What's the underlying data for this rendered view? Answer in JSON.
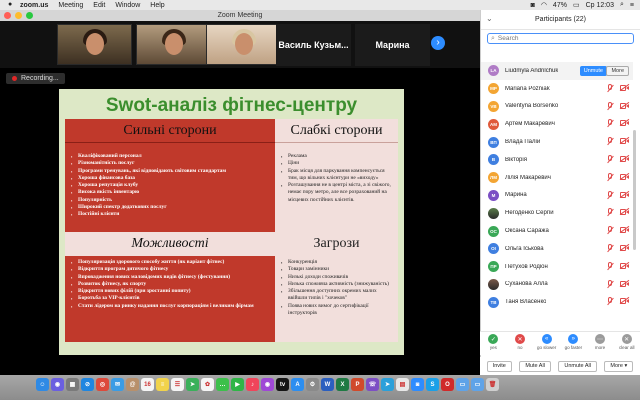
{
  "menubar": {
    "app": "zoom.us",
    "items": [
      "Meeting",
      "Edit",
      "Window",
      "Help"
    ],
    "battery": "47%",
    "time": "Ср 12:03"
  },
  "window": {
    "title": "Zoom Meeting"
  },
  "videos": {
    "names": [
      "Василь Кузьм...",
      "Марина"
    ]
  },
  "recording": {
    "label": "Recording..."
  },
  "slide": {
    "title": "Swot-аналіз фітнес-центру",
    "strengths": {
      "header": "Сильні сторони",
      "items": [
        "Кваліфікований персонал",
        "Різноманітність послуг",
        "Програми тренувань, які відповідають світовим стандартам",
        "Хороша фінансова база",
        "Хороша репутація клубу",
        "Висока якість інвентарю",
        "Популярність",
        "Широкий спектр додаткових послуг",
        "Постійні клієнти"
      ]
    },
    "weaknesses": {
      "header": "Слабкі сторони",
      "items": [
        "Реклама",
        "Ціни",
        "Брак місця для паркування компенсується тим, що вільних клієнтури не «виходу»",
        "Розташування не в центрі міста, а зі свіжого, немає пору метро, але все розрахований на місцевих постійних клієнтів."
      ]
    },
    "opportunities": {
      "header": "Можливості",
      "items": [
        "Популяризація здорового способу життя (як варіант фітнес)",
        "Відкриття програм дитячого фітнесу",
        "Впровадження нових маловідомих видів фітнесу (фестування)",
        "Розвиток фітнесу, як спорту",
        "Відкриття нових філій (при зростанні попиту)",
        "Боротьба за VIP-клієнтів",
        "Стати лідером на ринку надання послуг корпораціям і великим фірмам"
      ]
    },
    "threats": {
      "header": "Загрози",
      "items": [
        "Конкуренція",
        "Товари замінники",
        "Низькі доходи споживачів",
        "Низька споживча активність (знижуваність)",
        "Збільшення доступних окремих малих ввійшли типів і \"хочеков\"",
        "Поява нових вимог до сертифікації інструкторів"
      ]
    }
  },
  "participants": {
    "title": "Participants (22)",
    "search_placeholder": "Search",
    "unmute_label": "Unmute",
    "more_label": "More",
    "list": [
      {
        "initials": "LA",
        "name": "Liudmyla Andrilchuk",
        "color": "#b07cc6",
        "photo": false
      },
      {
        "initials": "MP",
        "name": "Mariana Pozniak",
        "color": "#f3a533",
        "photo": false
      },
      {
        "initials": "VB",
        "name": "Valentyna Borsenko",
        "color": "#f3a533",
        "photo": false
      },
      {
        "initials": "AM",
        "name": "Артем Макаревич",
        "color": "#e05a3a",
        "photo": false
      },
      {
        "initials": "ВП",
        "name": "Влада Палій",
        "color": "#3f7fe0",
        "photo": false
      },
      {
        "initials": "B",
        "name": "Вікторія",
        "color": "#3f7fe0",
        "photo": false
      },
      {
        "initials": "ЛМ",
        "name": "Лілія Макаревич",
        "color": "#f3a533",
        "photo": false
      },
      {
        "initials": "M",
        "name": "Марина",
        "color": "#7b4fc4",
        "photo": false
      },
      {
        "initials": "",
        "name": "Негоденко Сергій",
        "color": "#5a7d4a",
        "photo": true
      },
      {
        "initials": "OC",
        "name": "Оксана Саража",
        "color": "#3aa857",
        "photo": false
      },
      {
        "initials": "OI",
        "name": "Ольга Іськова",
        "color": "#3f7fe0",
        "photo": false
      },
      {
        "initials": "ПР",
        "name": "Петухов Родіон",
        "color": "#3aa857",
        "photo": false
      },
      {
        "initials": "",
        "name": "Суханова Алла",
        "color": "#7a5a4a",
        "photo": true
      },
      {
        "initials": "TB",
        "name": "Таня Власенко",
        "color": "#3f7fe0",
        "photo": false
      }
    ],
    "reactions": [
      "yes",
      "no",
      "go slower",
      "go faster",
      "more",
      "clear all"
    ],
    "reaction_colors": [
      "#3aa857",
      "#e04a4a",
      "#2d8cff",
      "#2d8cff",
      "#9b9b9b",
      "#9b9b9b"
    ],
    "reaction_glyphs": [
      "✓",
      "✕",
      "«",
      "»",
      "⋯",
      "✕"
    ]
  },
  "bottom_buttons": {
    "invite": "Invite",
    "mute_all": "Mute All",
    "unmute_all": "Unmute All",
    "more": "More ▾"
  },
  "dock": {
    "icons": [
      {
        "name": "finder-icon",
        "color": "#2f8ae5",
        "glyph": "☺"
      },
      {
        "name": "siri-icon",
        "color": "#6b5fe0",
        "glyph": "◉"
      },
      {
        "name": "launchpad-icon",
        "color": "#7a7a7a",
        "glyph": "▦"
      },
      {
        "name": "safari-icon",
        "color": "#1f86e0",
        "glyph": "⊘"
      },
      {
        "name": "chrome-icon",
        "color": "#dd4a3b",
        "glyph": "◎"
      },
      {
        "name": "mail-icon",
        "color": "#3a9ce5",
        "glyph": "✉"
      },
      {
        "name": "contacts-icon",
        "color": "#b8906b",
        "glyph": "@"
      },
      {
        "name": "calendar-icon",
        "color": "#f5f5f5",
        "glyph": "16"
      },
      {
        "name": "notes-icon",
        "color": "#f1d34b",
        "glyph": "≡"
      },
      {
        "name": "reminders-icon",
        "color": "#f5f5f5",
        "glyph": "☰"
      },
      {
        "name": "maps-icon",
        "color": "#3ab05a",
        "glyph": "➤"
      },
      {
        "name": "photos-icon",
        "color": "#f5f5f5",
        "glyph": "✿"
      },
      {
        "name": "messages-icon",
        "color": "#3cc04b",
        "glyph": "…"
      },
      {
        "name": "facetime-icon",
        "color": "#2fb547",
        "glyph": "▶"
      },
      {
        "name": "music-icon",
        "color": "#f0455b",
        "glyph": "♪"
      },
      {
        "name": "podcasts-icon",
        "color": "#9f48d6",
        "glyph": "◉"
      },
      {
        "name": "tv-icon",
        "color": "#151515",
        "glyph": "tv"
      },
      {
        "name": "appstore-icon",
        "color": "#2c8ef0",
        "glyph": "A"
      },
      {
        "name": "settings-icon",
        "color": "#8a8a8a",
        "glyph": "⚙"
      },
      {
        "name": "word-icon",
        "color": "#2b5fbf",
        "glyph": "W"
      },
      {
        "name": "excel-icon",
        "color": "#1f7a43",
        "glyph": "X"
      },
      {
        "name": "powerpoint-icon",
        "color": "#d04a2b",
        "glyph": "P"
      },
      {
        "name": "viber-icon",
        "color": "#7d4fc4",
        "glyph": "☏"
      },
      {
        "name": "telegram-icon",
        "color": "#2aa0da",
        "glyph": "➤"
      },
      {
        "name": "preview-icon",
        "color": "#e8e8e8",
        "glyph": "▤"
      },
      {
        "name": "zoom-icon",
        "color": "#2d8cff",
        "glyph": "◙"
      },
      {
        "name": "skype-icon",
        "color": "#1aa0e8",
        "glyph": "S"
      },
      {
        "name": "opera-icon",
        "color": "#d02a2a",
        "glyph": "O"
      },
      {
        "name": "folder-icon",
        "color": "#5fa3e8",
        "glyph": "▭"
      },
      {
        "name": "folder-icon-2",
        "color": "#5fa3e8",
        "glyph": "▭"
      },
      {
        "name": "trash-icon",
        "color": "#cfcfcf",
        "glyph": "🗑"
      }
    ]
  }
}
